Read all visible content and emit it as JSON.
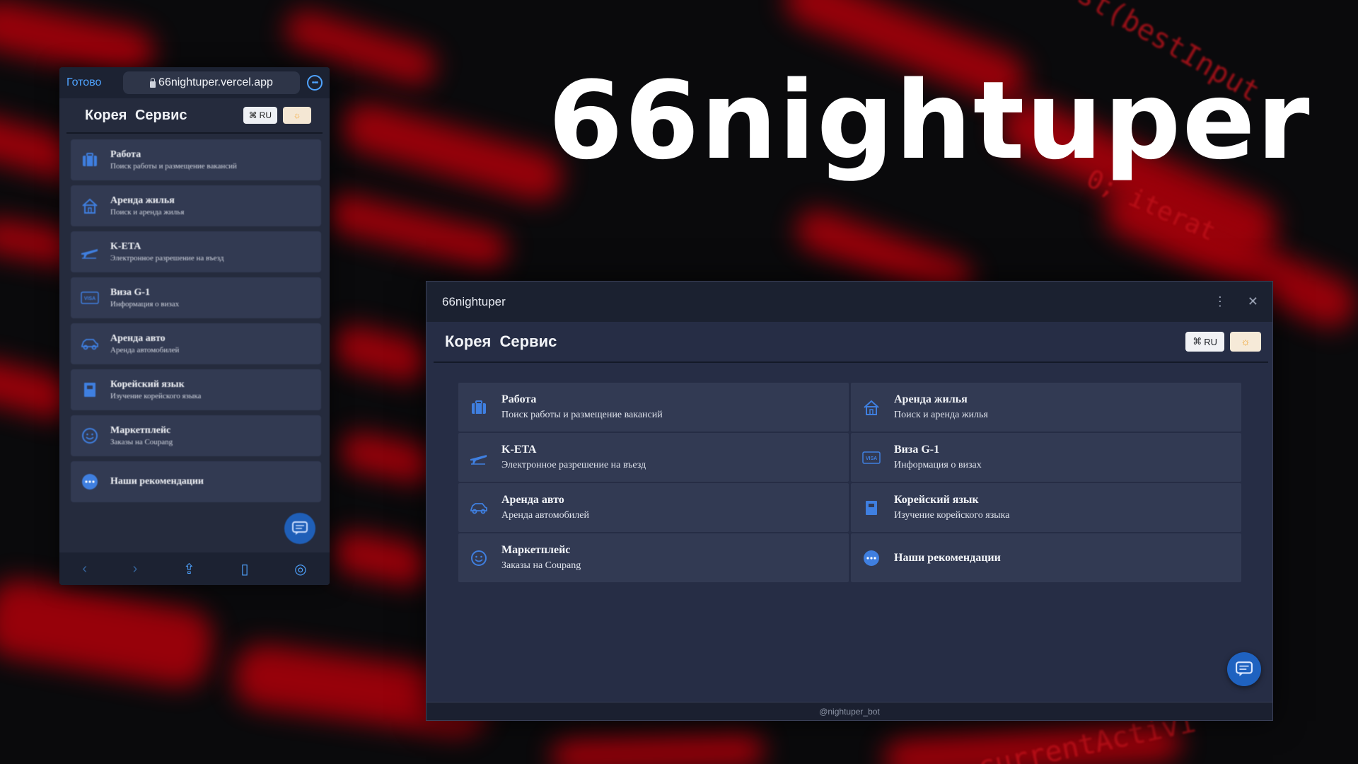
{
  "logo_text": "66nightuper",
  "phone": {
    "done_label": "Готово",
    "url": "66nightuper.vercel.app",
    "header_title": "Корея  Сервис",
    "lang_label": "RU",
    "items": [
      {
        "title": "Работа",
        "subtitle": "Поиск работы и размещение вакансий",
        "icon": "briefcase-icon"
      },
      {
        "title": "Аренда жилья",
        "subtitle": "Поиск и аренда жилья",
        "icon": "house-icon"
      },
      {
        "title": "K-ETA",
        "subtitle": "Электронное разрешение на въезд",
        "icon": "airplane-icon"
      },
      {
        "title": "Виза G-1",
        "subtitle": "Информация о визах",
        "icon": "visa-card-icon"
      },
      {
        "title": "Аренда авто",
        "subtitle": "Аренда автомобилей",
        "icon": "car-icon"
      },
      {
        "title": "Корейский язык",
        "subtitle": "Изучение корейского языка",
        "icon": "book-icon"
      },
      {
        "title": "Маркетплейс",
        "subtitle": "Заказы на Coupang",
        "icon": "smile-icon"
      },
      {
        "title": "Наши рекомендации",
        "subtitle": "",
        "icon": "chat-dots-icon"
      }
    ]
  },
  "window": {
    "title": "66nightuper",
    "header_title": "Корея  Сервис",
    "lang_label": "RU",
    "cards": [
      {
        "title": "Работа",
        "subtitle": "Поиск работы и размещение вакансий",
        "icon": "briefcase-icon"
      },
      {
        "title": "Аренда жилья",
        "subtitle": "Поиск и аренда жилья",
        "icon": "house-icon"
      },
      {
        "title": "K-ETA",
        "subtitle": "Электронное разрешение на въезд",
        "icon": "airplane-icon"
      },
      {
        "title": "Виза G-1",
        "subtitle": "Информация о визах",
        "icon": "visa-card-icon"
      },
      {
        "title": "Аренда авто",
        "subtitle": "Аренда автомобилей",
        "icon": "car-icon"
      },
      {
        "title": "Корейский язык",
        "subtitle": "Изучение корейского языка",
        "icon": "book-icon"
      },
      {
        "title": "Маркетплейс",
        "subtitle": "Заказы на Coupang",
        "icon": "smile-icon"
      },
      {
        "title": "Наши рекомендации",
        "subtitle": "",
        "icon": "chat-dots-icon"
      }
    ],
    "footer": "@nightuper_bot"
  },
  "colors": {
    "accent": "#3f7fe0",
    "panel": "#262d45",
    "card": "#323a53",
    "background_red": "#b0000a"
  }
}
